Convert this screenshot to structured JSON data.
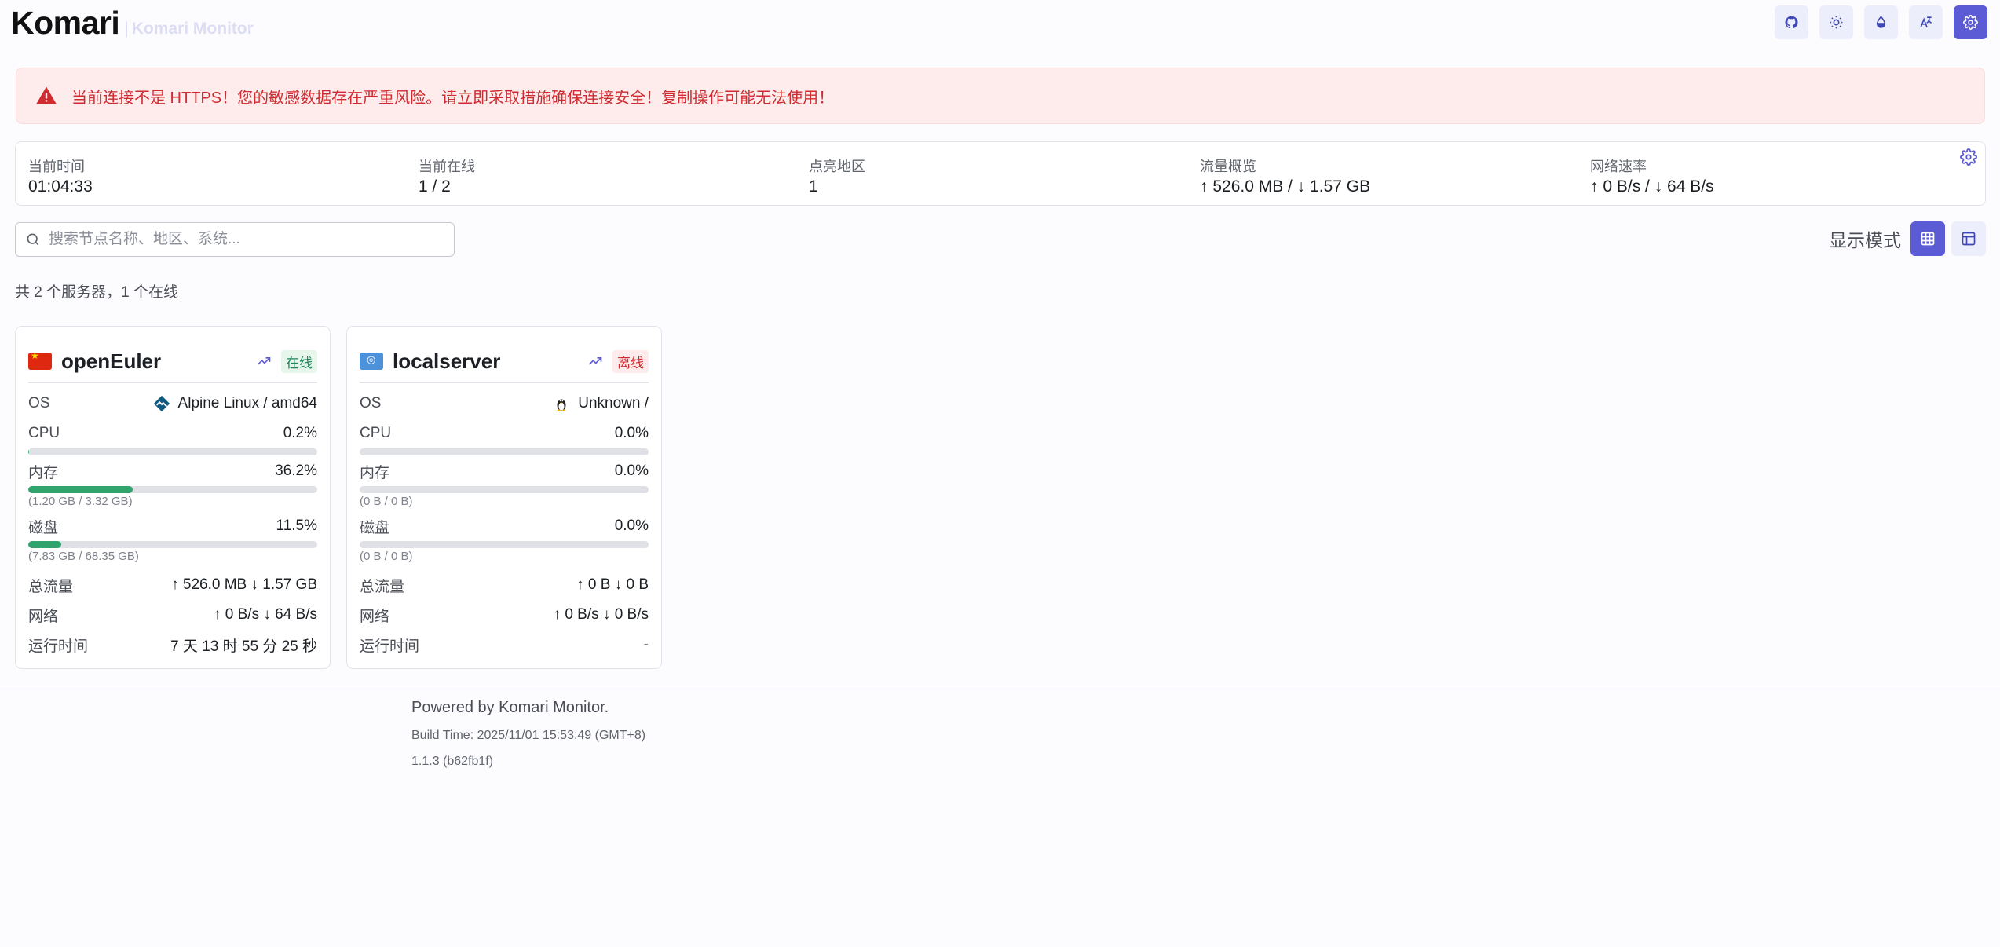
{
  "header": {
    "brand": "Komari",
    "separator": "|",
    "subtitle": "Komari Monitor",
    "toolbar": [
      "github-icon",
      "sun-icon",
      "drop-icon",
      "translate-icon",
      "gear-icon"
    ]
  },
  "alert": {
    "text": "当前连接不是 HTTPS！您的敏感数据存在严重风险。请立即采取措施确保连接安全！复制操作可能无法使用！",
    "color": "#ce2c31"
  },
  "stats": {
    "time": {
      "label": "当前时间",
      "value": "01:04:33"
    },
    "online": {
      "label": "当前在线",
      "value": "1 / 2"
    },
    "regions": {
      "label": "点亮地区",
      "value": "1"
    },
    "traffic": {
      "label": "流量概览",
      "value": "↑ 526.0 MB / ↓ 1.57 GB"
    },
    "speed": {
      "label": "网络速率",
      "value": "↑ 0 B/s / ↓ 64 B/s"
    }
  },
  "search": {
    "placeholder": "搜索节点名称、地区、系统..."
  },
  "display_mode": {
    "label": "显示模式",
    "options": [
      "grid-icon",
      "table-icon"
    ],
    "selected": "grid-icon"
  },
  "summary": "共 2 个服务器，1 个在线",
  "servers": [
    {
      "name": "openEuler",
      "status": "在线",
      "os_label": "OS",
      "os": "Alpine Linux / amd64",
      "cpu_label": "CPU",
      "cpu": "0.2%",
      "cpu_level": 0.002,
      "mem_label": "内存",
      "mem": "36.2%",
      "mem_level": 0.362,
      "mem_detail": "(1.20 GB / 3.32 GB)",
      "disk_label": "磁盘",
      "disk": "11.5%",
      "disk_level": 0.115,
      "disk_detail": "(7.83 GB / 68.35 GB)",
      "traffic_label": "总流量",
      "traffic": "↑ 526.0 MB ↓ 1.57 GB",
      "net_label": "网络",
      "net": "↑ 0 B/s ↓ 64 B/s",
      "uptime_label": "运行时间",
      "uptime": "7 天 13 时 55 分 25 秒"
    },
    {
      "name": "localserver",
      "status": "离线",
      "os_label": "OS",
      "os": "Unknown /",
      "cpu_label": "CPU",
      "cpu": "0.0%",
      "cpu_level": 0,
      "mem_label": "内存",
      "mem": "0.0%",
      "mem_level": 0,
      "mem_detail": "(0 B / 0 B)",
      "disk_label": "磁盘",
      "disk": "0.0%",
      "disk_level": 0,
      "disk_detail": "(0 B / 0 B)",
      "traffic_label": "总流量",
      "traffic": "↑ 0 B ↓ 0 B",
      "net_label": "网络",
      "net": "↑ 0 B/s ↓ 0 B/s",
      "uptime_label": "运行时间",
      "uptime": "-"
    }
  ],
  "footer": {
    "powered": "Powered by Komari Monitor.",
    "build": "Build Time: 2025/11/01 15:53:49 (GMT+8)",
    "version": "1.1.3 (b62fb1f)"
  }
}
